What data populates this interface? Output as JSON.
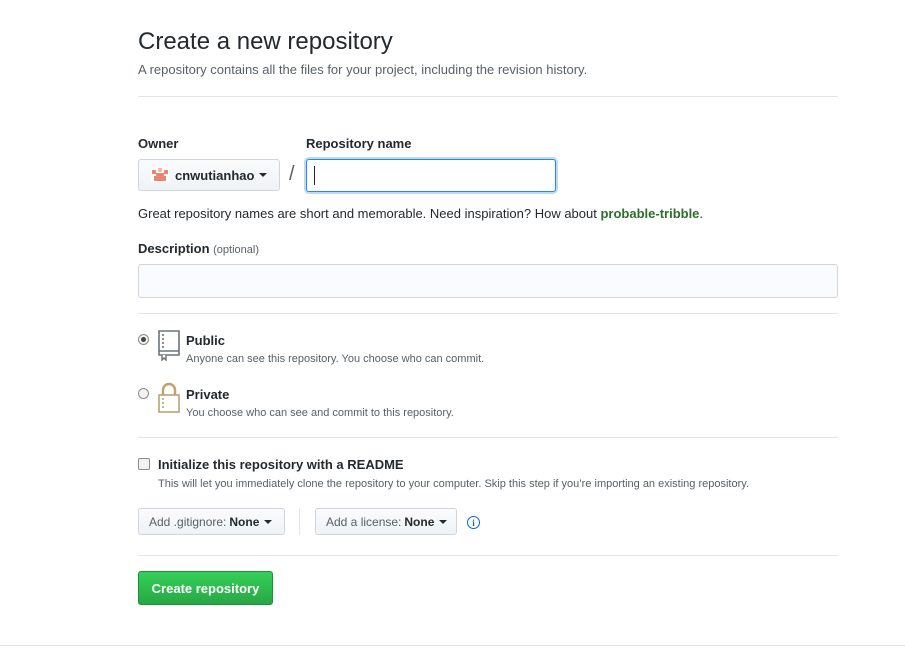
{
  "header": {
    "title": "Create a new repository",
    "subtitle": "A repository contains all the files for your project, including the revision history."
  },
  "owner": {
    "label": "Owner",
    "selected": "cnwutianhao"
  },
  "repo_name": {
    "label": "Repository name",
    "value": "",
    "separator": "/"
  },
  "hint": {
    "text": "Great repository names are short and memorable. Need inspiration? How about ",
    "suggestion": "probable-tribble",
    "end": "."
  },
  "description": {
    "label": "Description",
    "optional": "(optional)",
    "value": ""
  },
  "visibility": {
    "public": {
      "label": "Public",
      "note": "Anyone can see this repository. You choose who can commit.",
      "checked": true
    },
    "private": {
      "label": "Private",
      "note": "You choose who can see and commit to this repository.",
      "checked": false
    }
  },
  "init": {
    "label": "Initialize this repository with a README",
    "note": "This will let you immediately clone the repository to your computer. Skip this step if you’re importing an existing repository.",
    "checked": false
  },
  "gitignore": {
    "prefix": "Add .gitignore:",
    "value": "None"
  },
  "license": {
    "prefix": "Add a license:",
    "value": "None"
  },
  "icons": {
    "avatar": "user-avatar-icon",
    "public": "repo-book-icon",
    "private": "lock-icon",
    "info": "info-icon"
  },
  "colors": {
    "accent": "#0366d6",
    "primary_button": "#28a745",
    "suggestion": "#2c6e2c"
  },
  "submit": {
    "label": "Create repository"
  }
}
